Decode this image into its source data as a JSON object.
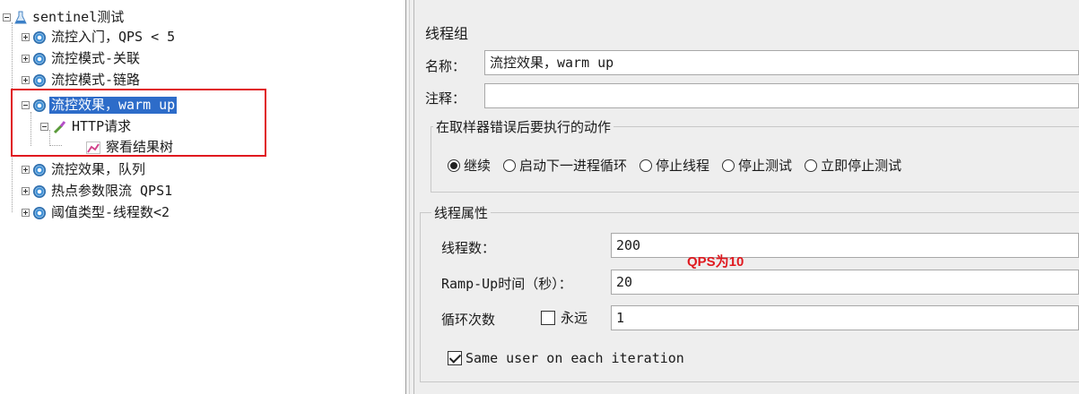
{
  "tree": {
    "root": {
      "label": "sentinel测试",
      "icon": "test-plan-flask-icon",
      "expanded": true
    },
    "groups": [
      {
        "label": "流控入门，QPS < 5",
        "icon": "thread-group-gear-icon",
        "expanded": false,
        "selected": false
      },
      {
        "label": "流控模式-关联",
        "icon": "thread-group-gear-icon",
        "expanded": false,
        "selected": false
      },
      {
        "label": "流控模式-链路",
        "icon": "thread-group-gear-icon",
        "expanded": false,
        "selected": false
      },
      {
        "label": "流控效果，warm up",
        "icon": "thread-group-gear-icon",
        "expanded": true,
        "selected": true
      },
      {
        "label": "流控效果，队列",
        "icon": "thread-group-gear-icon",
        "expanded": false,
        "selected": false
      },
      {
        "label": "热点参数限流 QPS1",
        "icon": "thread-group-gear-icon",
        "expanded": false,
        "selected": false
      },
      {
        "label": "阈值类型-线程数<2",
        "icon": "thread-group-gear-icon",
        "expanded": false,
        "selected": false
      }
    ],
    "sampler": {
      "label": "HTTP请求",
      "icon": "http-sampler-pipette-icon",
      "expanded": true
    },
    "listener": {
      "label": "察看结果树",
      "icon": "result-tree-chart-icon"
    },
    "highlight_color": "#e0191f",
    "selection_color": "#2d6cc9"
  },
  "panel": {
    "title": "线程组",
    "name_label": "名称：",
    "name_value": "流控效果，warm up",
    "comment_label": "注释：",
    "comment_value": "",
    "error_action": {
      "legend": "在取样器错误后要执行的动作",
      "options": [
        "继续",
        "启动下一进程循环",
        "停止线程",
        "停止测试",
        "立即停止测试"
      ],
      "selected": "继续"
    },
    "thread_props": {
      "legend": "线程属性",
      "threads_label": "线程数：",
      "threads_value": "200",
      "rampup_label": "Ramp-Up时间（秒）：",
      "rampup_value": "20",
      "loop_label": "循环次数",
      "forever_label": "永远",
      "forever_checked": false,
      "loop_value": "1",
      "same_user_label": "Same user on each iteration",
      "same_user_checked": true
    },
    "annotation": "QPS为10",
    "annotation_color": "#e0191f"
  }
}
